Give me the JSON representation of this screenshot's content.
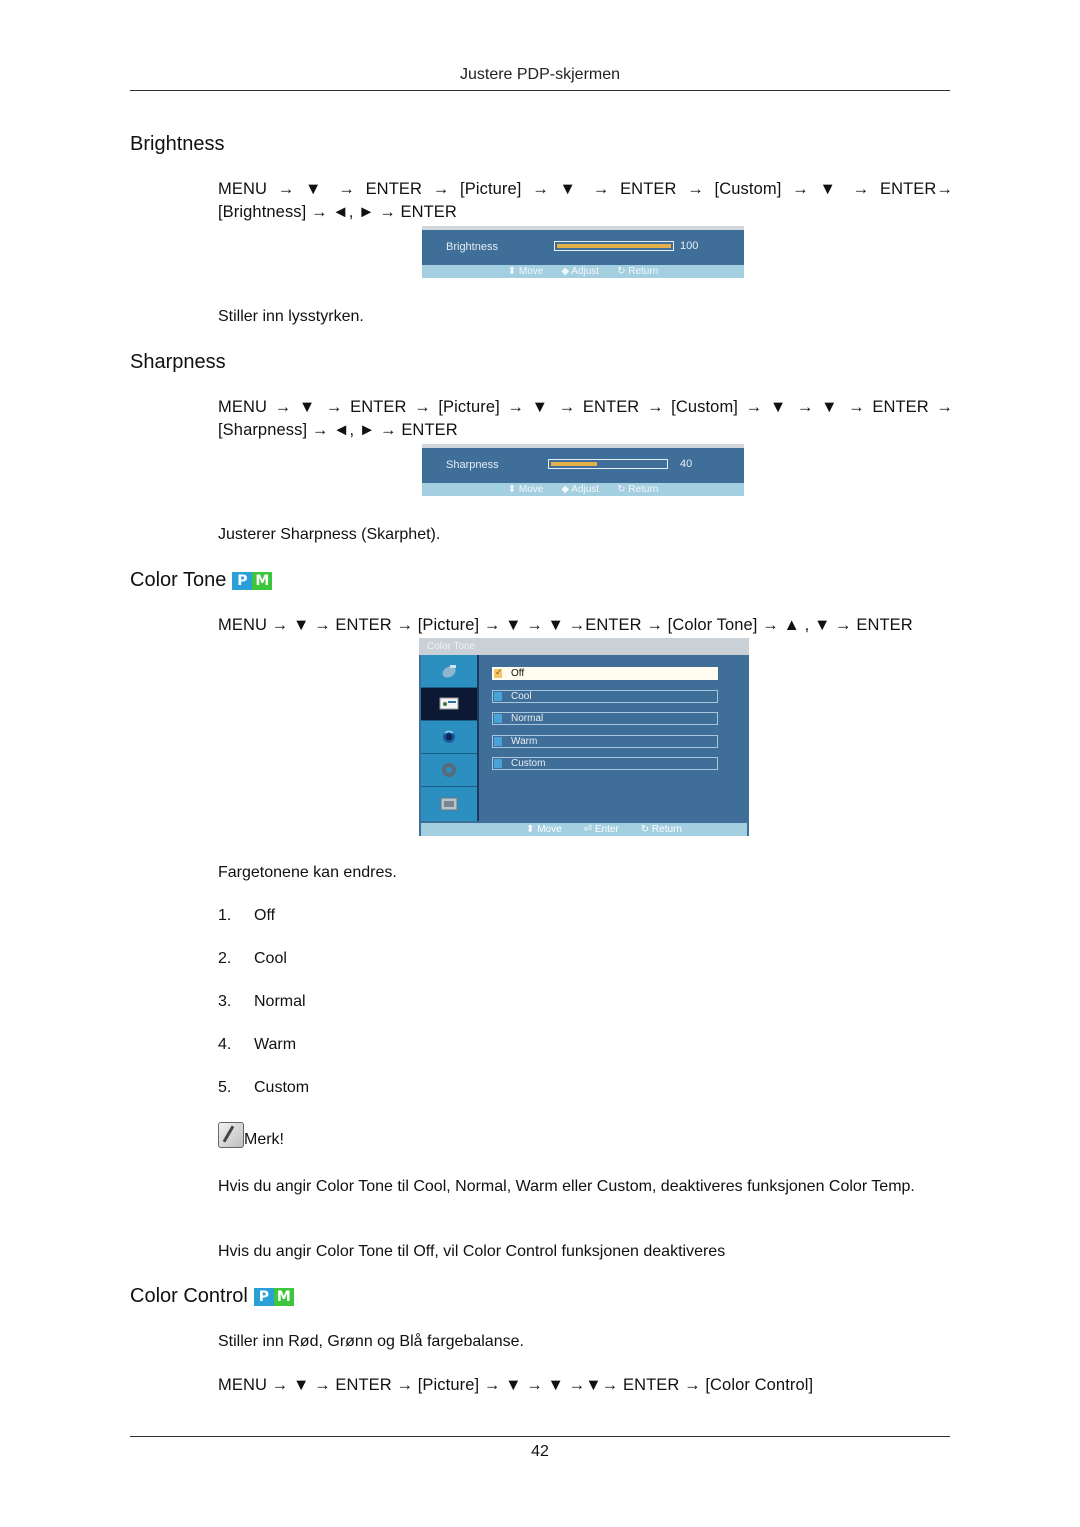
{
  "header": {
    "running_title": "Justere PDP-skjermen"
  },
  "sections": {
    "brightness": {
      "title": "Brightness",
      "path_line1": [
        "MENU",
        "→",
        "▼",
        "→",
        "ENTER",
        "→",
        "[Picture]",
        "→",
        "▼",
        "→",
        "ENTER",
        "→",
        "[Custom]",
        "→",
        "▼",
        "→",
        "ENTER→"
      ],
      "path_line2": "[Brightness] → ◄, ► → ENTER",
      "osd": {
        "label": "Brightness",
        "value": "100",
        "fraction": 1.0,
        "footer": {
          "move": "Move",
          "adjust": "Adjust",
          "return": "Return"
        }
      },
      "description": "Stiller inn lysstyrken."
    },
    "sharpness": {
      "title": "Sharpness",
      "path_line1": "MENU → ▼ → ENTER → [Picture] → ▼ → ENTER → [Custom] → ▼ → ▼ → ENTER →",
      "path_line2": "[Sharpness] → ◄, ► → ENTER",
      "osd": {
        "label": "Sharpness",
        "value": "40",
        "fraction": 0.4,
        "footer": {
          "move": "Move",
          "adjust": "Adjust",
          "return": "Return"
        }
      },
      "description": "Justerer Sharpness (Skarphet)."
    },
    "color_tone": {
      "title": "Color Tone",
      "badge": {
        "p": "P",
        "m": "M"
      },
      "path": "MENU → ▼ → ENTER → [Picture] → ▼ → ▼ →ENTER → [Color Tone] → ▲ , ▼ → ENTER",
      "menu": {
        "title": "Color Tone",
        "side_icons": [
          "satellite-icon",
          "picture-icon",
          "sound-icon",
          "setup-icon",
          "input-icon"
        ],
        "active_side_index": 1,
        "options": [
          "Off",
          "Cool",
          "Normal",
          "Warm",
          "Custom"
        ],
        "selected": "Off",
        "footer": {
          "move": "Move",
          "enter": "Enter",
          "return": "Return"
        }
      },
      "description": "Fargetonene kan endres.",
      "list": [
        {
          "num": "1.",
          "label": "Off"
        },
        {
          "num": "2.",
          "label": "Cool"
        },
        {
          "num": "3.",
          "label": "Normal"
        },
        {
          "num": "4.",
          "label": "Warm"
        },
        {
          "num": "5.",
          "label": "Custom"
        }
      ],
      "note_label": "Merk!",
      "note_para1": "Hvis du angir Color Tone til Cool, Normal, Warm eller Custom, deaktiveres funksjonen Color Temp.",
      "note_para2": "Hvis du angir Color Tone til Off, vil Color Control funksjonen deaktiveres"
    },
    "color_control": {
      "title": "Color Control",
      "badge": {
        "p": "P",
        "m": "M"
      },
      "description": "Stiller inn Rød, Grønn og Blå fargebalanse.",
      "path": "MENU → ▼ → ENTER → [Picture] → ▼ → ▼ →▼→ ENTER → [Color Control]"
    }
  },
  "footer": {
    "page_number": "42"
  },
  "colors": {
    "osd_bg": "#3f6e98",
    "osd_footer": "#a3cfe0",
    "slider_fill": "#e4b04a",
    "badge_p": "#2a9fd8",
    "badge_m": "#3cc63c"
  }
}
